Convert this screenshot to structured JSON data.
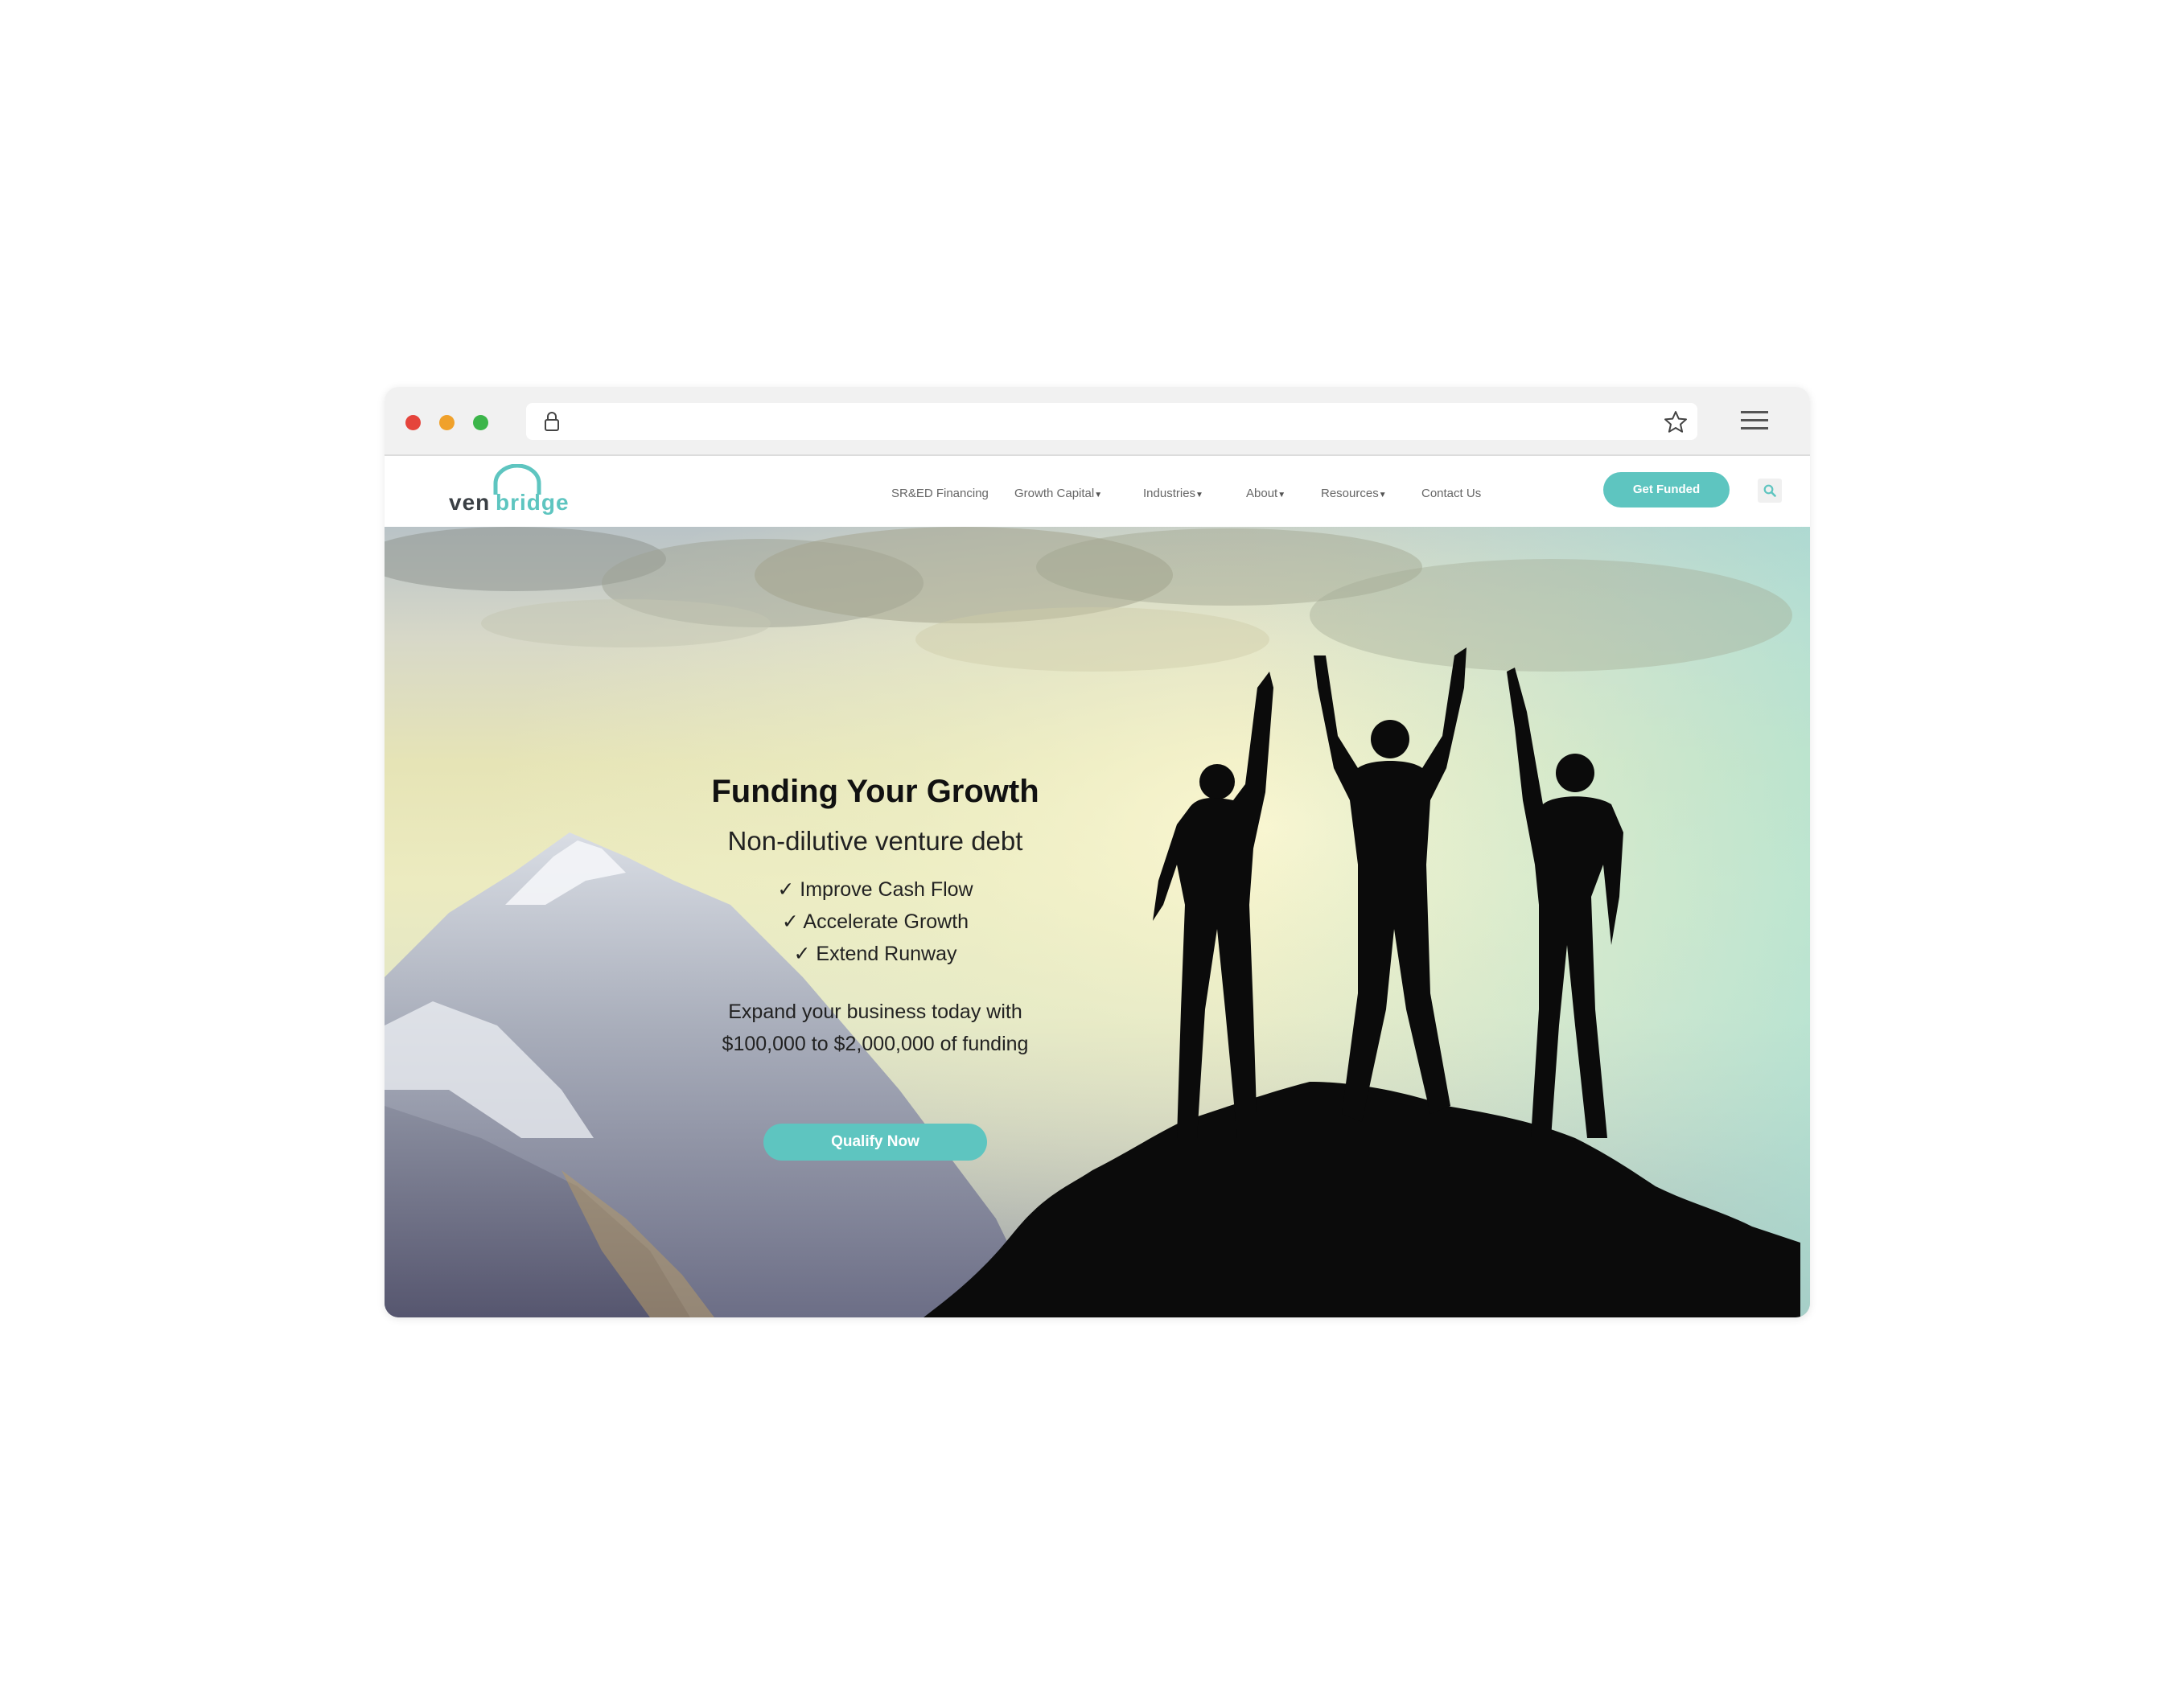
{
  "browser": {
    "url": "",
    "icons": [
      "lock-icon",
      "star-icon",
      "hamburger-menu-icon"
    ]
  },
  "site": {
    "logo": {
      "part1": "ven",
      "part2": "bridge"
    },
    "nav": [
      {
        "label": "SR&ED Financing",
        "dropdown": false
      },
      {
        "label": "Growth Capital",
        "dropdown": true
      },
      {
        "label": "Industries",
        "dropdown": true
      },
      {
        "label": "About",
        "dropdown": true
      },
      {
        "label": "Resources",
        "dropdown": true
      },
      {
        "label": "Contact Us",
        "dropdown": false
      }
    ],
    "cta": "Get Funded",
    "accent": "#5ec5c0"
  },
  "hero": {
    "title": "Funding Your Growth",
    "subtitle": "Non-dilutive venture debt",
    "checks": [
      "✓ Improve Cash Flow",
      "✓ Accelerate Growth",
      "✓ Extend Runway"
    ],
    "body_line1": "Expand your business today with",
    "body_line2": "$100,000 to $2,000,000 of funding",
    "button": "Qualify Now"
  }
}
